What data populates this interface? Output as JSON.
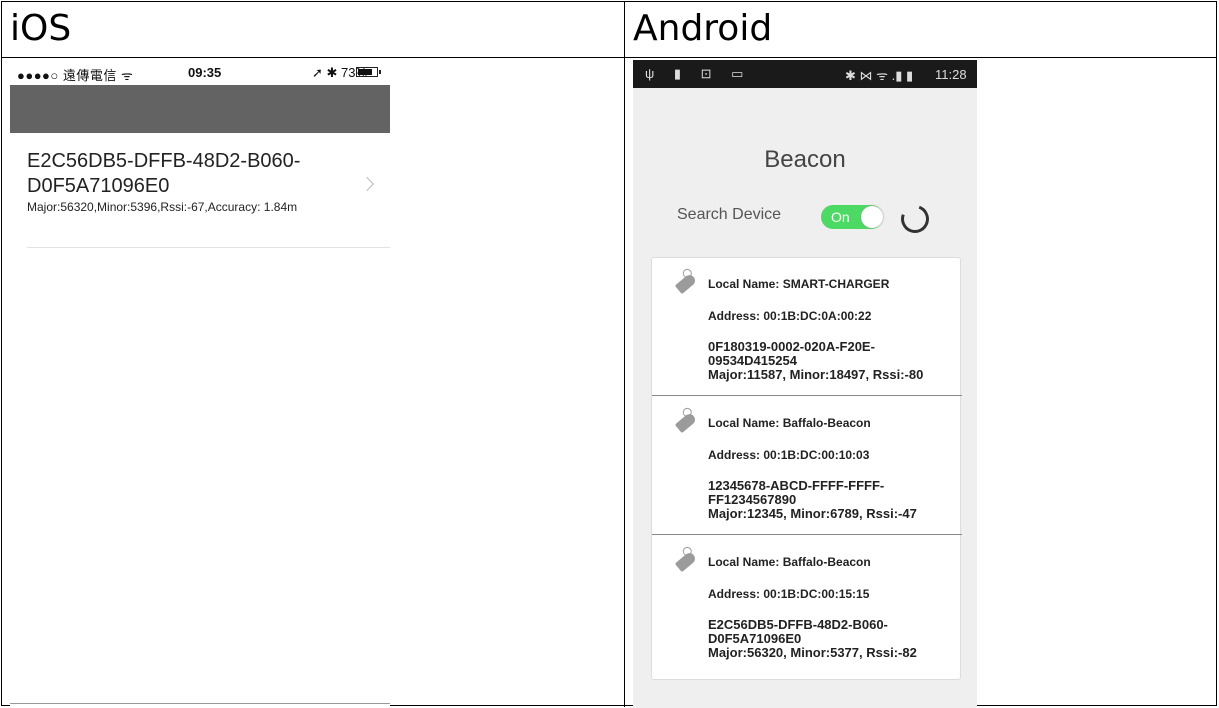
{
  "columns": {
    "ios": "iOS",
    "android": "Android"
  },
  "ios": {
    "status": {
      "carrier": "●●●●○ 遠傳電信 ᯤ",
      "time": "09:35",
      "right": "➚ ✱ 73%"
    },
    "cell": {
      "uuid": "E2C56DB5-DFFB-48D2-B060-D0F5A71096E0",
      "detail": "Major:56320,Minor:5396,Rssi:-67,Accuracy: 1.84m"
    }
  },
  "android": {
    "status": {
      "left": "ψ ▮ ⊡ ▭",
      "right": "✱ ⋈ ᯤ .▮ ▮",
      "time": "11:28"
    },
    "title": "Beacon",
    "search_label": "Search Device",
    "toggle_label": "On",
    "devices": [
      {
        "name": "Local Name: SMART-CHARGER",
        "address": "Address: 00:1B:DC:0A:00:22",
        "uuid": "0F180319-0002-020A-F20E-09534D415254",
        "stats": "Major:11587, Minor:18497, Rssi:-80"
      },
      {
        "name": "Local Name: Baffalo-Beacon",
        "address": "Address: 00:1B:DC:00:10:03",
        "uuid": "12345678-ABCD-FFFF-FFFF-FF1234567890",
        "stats": "Major:12345, Minor:6789, Rssi:-47"
      },
      {
        "name": "Local Name: Baffalo-Beacon",
        "address": "Address: 00:1B:DC:00:15:15",
        "uuid": "E2C56DB5-DFFB-48D2-B060-D0F5A71096E0",
        "stats": "Major:56320, Minor:5377, Rssi:-82"
      }
    ]
  }
}
